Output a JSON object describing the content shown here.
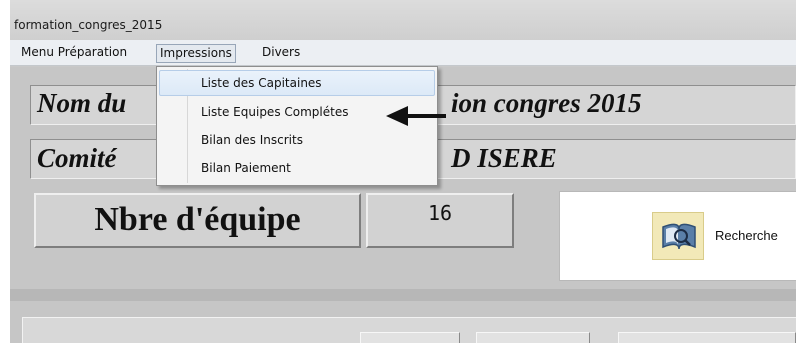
{
  "window": {
    "title": "formation_congres_2015"
  },
  "menubar": {
    "items": [
      {
        "label": "Menu Préparation"
      },
      {
        "label": "Impressions",
        "active": true
      },
      {
        "label": "Divers"
      }
    ]
  },
  "dropdown": {
    "items": [
      {
        "label": "Liste des Capitaines",
        "highlighted": true
      },
      {
        "label": "Liste Equipes Complétes"
      },
      {
        "label": "Bilan des Inscrits"
      },
      {
        "label": "Bilan Paiement"
      }
    ]
  },
  "form": {
    "nom_left": "Nom du",
    "nom_right": "ion  congres  2015",
    "comite_left": "Comité",
    "comite_right": "D ISERE",
    "nbre_label": "Nbre d'équipe",
    "nbre_value": "16"
  },
  "search": {
    "label": "Recherche",
    "icon": "search-book-icon"
  },
  "annotation": {
    "icon": "left-arrow-icon",
    "color": "#111111"
  }
}
